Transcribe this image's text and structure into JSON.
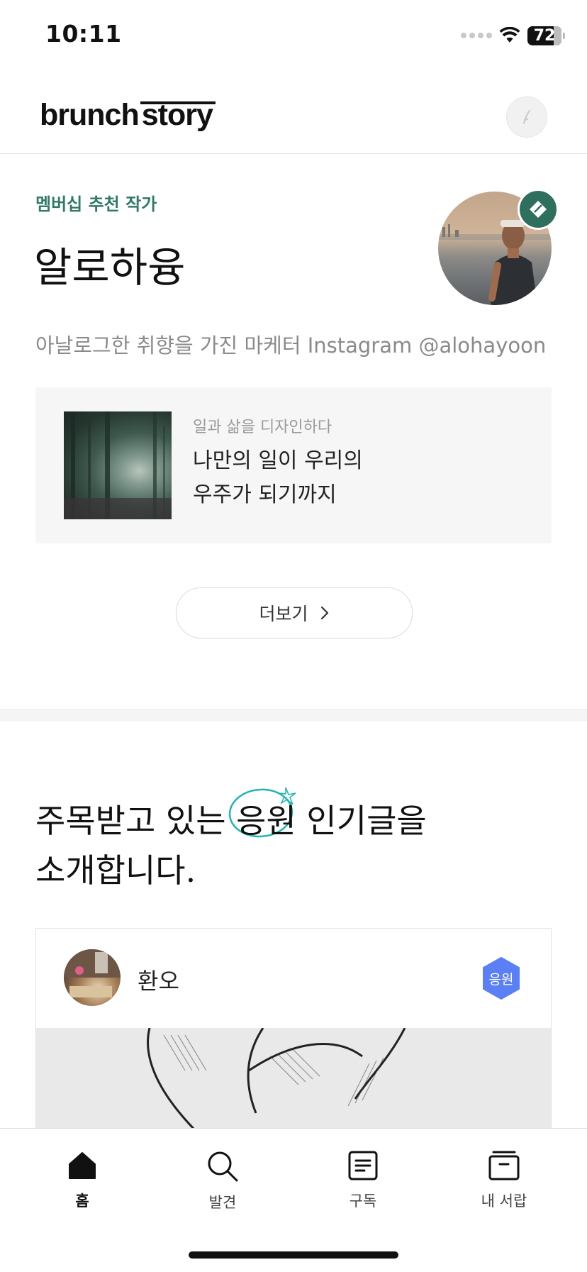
{
  "status_bar": {
    "time": "10:11",
    "battery": "72"
  },
  "header": {
    "logo_part1": "brunch",
    "logo_part2": "story"
  },
  "author_section": {
    "label": "멤버십 추천 작가",
    "name": "알로하융",
    "description": "아날로그한 취향을 가진 마케터 Instagram @alohayoon",
    "article": {
      "category": "일과 삶을 디자인하다",
      "title_line1": "나만의 일이 우리의",
      "title_line2": "우주가 되기까지"
    },
    "more_button": "더보기"
  },
  "popular_section": {
    "title_part1": "주목받고 있는 ",
    "title_highlight": "응원",
    "title_part2": " 인기글을",
    "title_line2": "소개합니다.",
    "post": {
      "author": "환오",
      "badge": "응원"
    }
  },
  "bottom_nav": [
    {
      "label": "홈",
      "icon": "home-icon",
      "active": true
    },
    {
      "label": "발견",
      "icon": "search-icon",
      "active": false
    },
    {
      "label": "구독",
      "icon": "document-icon",
      "active": false
    },
    {
      "label": "내 서랍",
      "icon": "drawer-icon",
      "active": false
    }
  ],
  "colors": {
    "accent_green": "#2f7a67",
    "badge_blue": "#5b7ff5",
    "highlight_teal": "#1fb5b0"
  }
}
